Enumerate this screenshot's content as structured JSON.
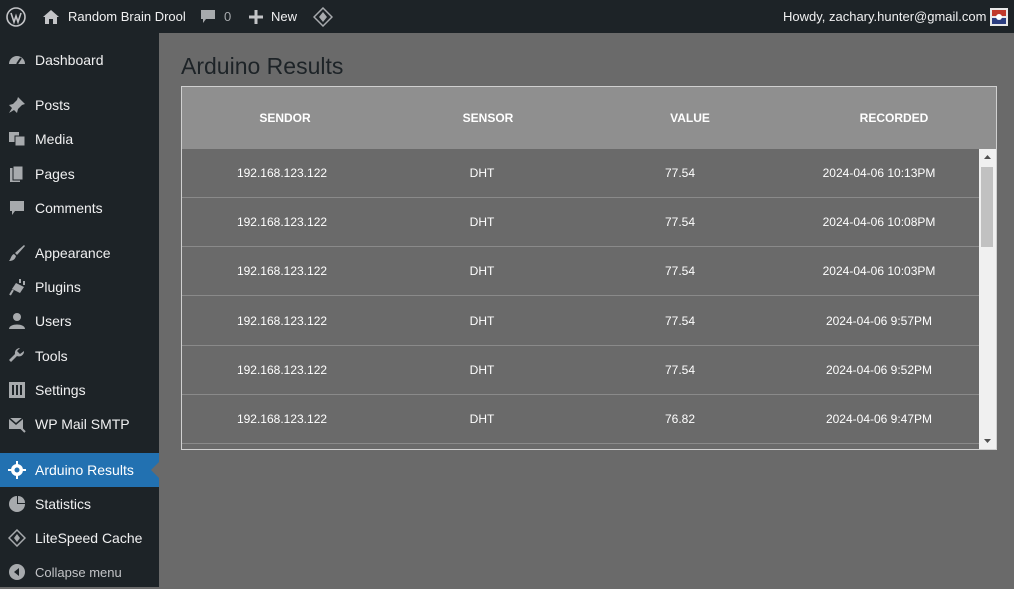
{
  "adminbar": {
    "site_name": "Random Brain Drool",
    "comments_count": "0",
    "new_label": "New",
    "howdy": "Howdy, zachary.hunter@gmail.com"
  },
  "sidebar": {
    "items": [
      {
        "label": "Dashboard",
        "icon": "dashboard-icon"
      },
      {
        "label": "Posts",
        "icon": "pushpin-icon"
      },
      {
        "label": "Media",
        "icon": "media-icon"
      },
      {
        "label": "Pages",
        "icon": "pages-icon"
      },
      {
        "label": "Comments",
        "icon": "comment-icon"
      },
      {
        "label": "Appearance",
        "icon": "paintbrush-icon"
      },
      {
        "label": "Plugins",
        "icon": "plugin-icon"
      },
      {
        "label": "Users",
        "icon": "user-icon"
      },
      {
        "label": "Tools",
        "icon": "wrench-icon"
      },
      {
        "label": "Settings",
        "icon": "settings-icon"
      },
      {
        "label": "WP Mail SMTP",
        "icon": "mail-icon"
      },
      {
        "label": "Arduino Results",
        "icon": "gear-icon"
      },
      {
        "label": "Statistics",
        "icon": "pie-chart-icon"
      },
      {
        "label": "LiteSpeed Cache",
        "icon": "litespeed-icon"
      }
    ],
    "collapse_label": "Collapse menu"
  },
  "main": {
    "title": "Arduino Results",
    "table": {
      "headers": [
        "SENDOR",
        "SENSOR",
        "VALUE",
        "RECORDED"
      ],
      "rows": [
        [
          "192.168.123.122",
          "DHT",
          "77.54",
          "2024-04-06 10:13PM"
        ],
        [
          "192.168.123.122",
          "DHT",
          "77.54",
          "2024-04-06 10:08PM"
        ],
        [
          "192.168.123.122",
          "DHT",
          "77.54",
          "2024-04-06 10:03PM"
        ],
        [
          "192.168.123.122",
          "DHT",
          "77.54",
          "2024-04-06 9:57PM"
        ],
        [
          "192.168.123.122",
          "DHT",
          "77.54",
          "2024-04-06 9:52PM"
        ],
        [
          "192.168.123.122",
          "DHT",
          "76.82",
          "2024-04-06 9:47PM"
        ]
      ]
    }
  },
  "colors": {
    "adminbar_bg": "#1d2327",
    "menu_current": "#2271b1",
    "content_bg": "#6a6a6a",
    "table_header_bg": "#8f8f8f"
  }
}
